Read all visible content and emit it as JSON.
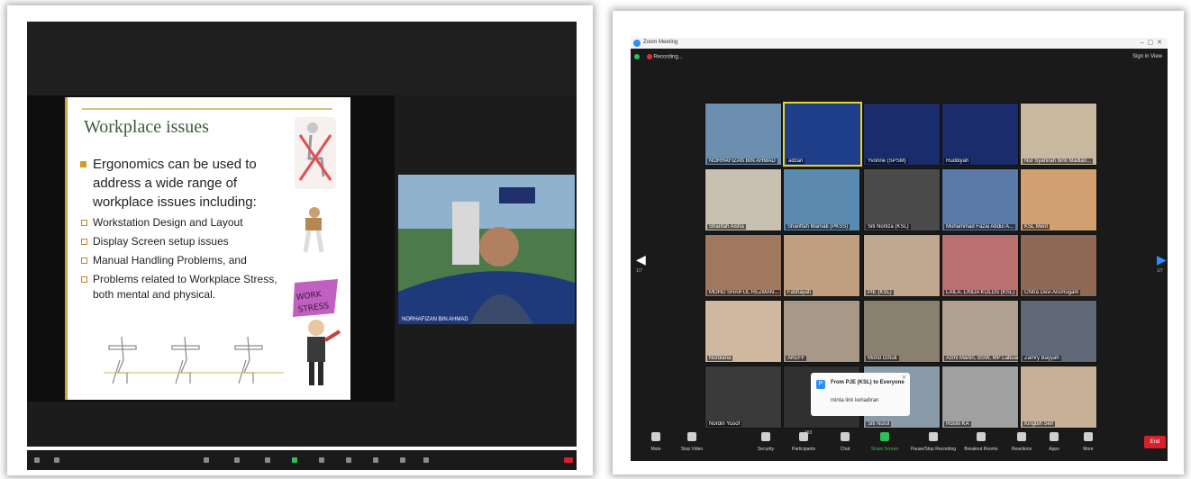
{
  "left": {
    "slide": {
      "title": "Workplace issues",
      "bullet": "Ergonomics can be used to address a wide range of workplace issues including:",
      "subs": [
        "Workstation Design and Layout",
        "Display Screen setup issues",
        "Manual Handling Problems, and",
        "Problems related to Workplace Stress, both mental and physical."
      ]
    },
    "speaker_label": "NORHAFIZAN BIN AHMAD"
  },
  "right": {
    "window_title": "Zoom Meeting",
    "recording": "Recording...",
    "sign_text": "Sign in  View",
    "page_left": "1/7",
    "page_right": "1/7",
    "tiles": [
      "NORHAFIZAN BIN AHMAD",
      "adzan",
      "Yvonne (SPSM)",
      "Ruddiyah",
      "Nur Syahirah binti Madlan...",
      "Sharifah Aisha",
      "Shariffah Marnati (PKSS)",
      "Siti Norliza (KSL)",
      "Muhammad Fazai Abdul A...",
      "KSL Merit",
      "MOHD SHAIFUL REZMAN...",
      "Fatihayati",
      "PIE (KSL)",
      "LAILA, LINDA KOLDS (KSL)",
      "Chitra Devi Arumugam",
      "Nordiana",
      "AKEFF",
      "Mohd Izmuk",
      "Azmi Martin, BSW, MP Labuan",
      "Zamry Bayyah",
      "Nordin Yusof",
      "",
      "Siti Nurul",
      "Roslili KA",
      "Kingbih Seri"
    ],
    "chat_popup": {
      "title": "From PJE (KSL) to Everyone",
      "message": "minta link kehadiran"
    },
    "toolbar": [
      "Mute",
      "Stop Video",
      "Security",
      "Participants",
      "Chat",
      "Share Screen",
      "Pause/Stop Recording",
      "Breakout Rooms",
      "Reactions",
      "Apps",
      "More"
    ],
    "participants_count": "153",
    "end_label": "End"
  }
}
